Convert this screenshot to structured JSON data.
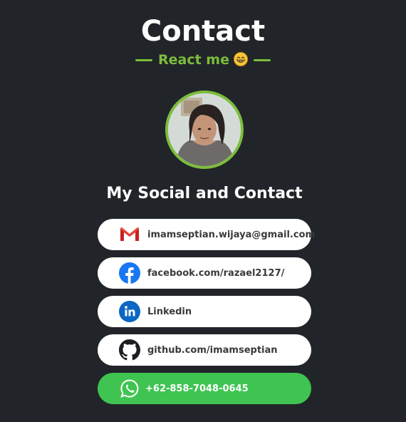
{
  "header": {
    "title": "Contact",
    "subtitle": "React me"
  },
  "section": {
    "title": "My Social and Contact"
  },
  "links": [
    {
      "id": "gmail",
      "label": "imamseptian.wijaya@gmail.com",
      "icon": "gmail-icon"
    },
    {
      "id": "facebook",
      "label": "facebook.com/razael2127/",
      "icon": "facebook-icon"
    },
    {
      "id": "linkedin",
      "label": "Linkedin",
      "icon": "linkedin-icon"
    },
    {
      "id": "github",
      "label": "github.com/imamseptian",
      "icon": "github-icon"
    },
    {
      "id": "whatsapp",
      "label": "+62-858-7048-0645",
      "icon": "whatsapp-icon"
    }
  ],
  "colors": {
    "background": "#212529",
    "accent": "#7cbd3d",
    "whatsapp": "#3fc451",
    "facebook": "#1877f2",
    "linkedin": "#0a66c2"
  }
}
